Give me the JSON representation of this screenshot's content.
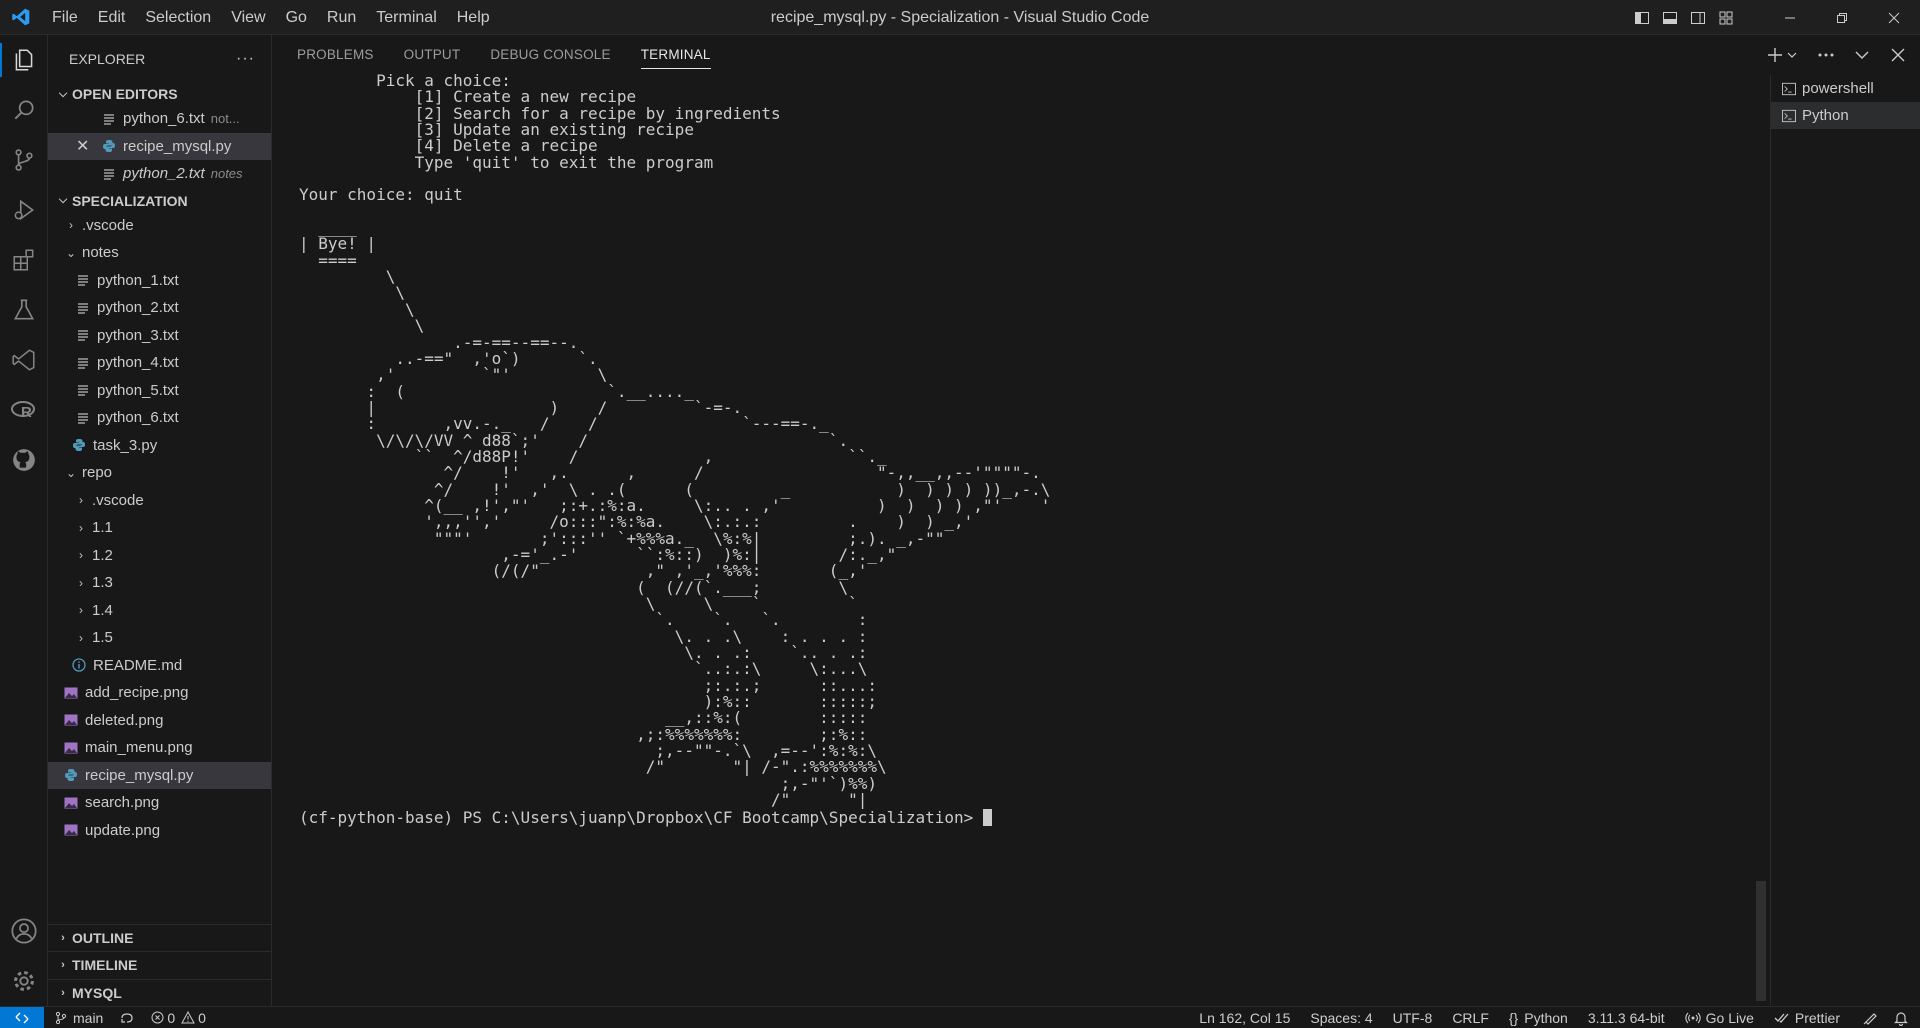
{
  "window": {
    "title": "recipe_mysql.py - Specialization - Visual Studio Code",
    "menu": [
      "File",
      "Edit",
      "Selection",
      "View",
      "Go",
      "Run",
      "Terminal",
      "Help"
    ],
    "accent": "#0078d4"
  },
  "activity_bar": {
    "top": [
      "files-icon",
      "search-icon",
      "source-control-icon",
      "run-debug-icon",
      "extensions-icon",
      "testing-icon",
      "visual-studio-icon",
      "r-icon",
      "github-icon"
    ],
    "bottom": [
      "accounts-icon",
      "settings-gear-icon"
    ]
  },
  "sidebar": {
    "title": "EXPLORER",
    "more": "···",
    "open_editors": {
      "label": "OPEN EDITORS",
      "items": [
        {
          "name": "python_6.txt",
          "desc": "not..."
        },
        {
          "name": "recipe_mysql.py",
          "close": "✕"
        },
        {
          "name": "python_2.txt",
          "desc": "notes"
        }
      ]
    },
    "workspace": {
      "label": "SPECIALIZATION",
      "items": [
        {
          "name": ".vscode"
        },
        {
          "name": "notes"
        },
        {
          "name": "python_1.txt"
        },
        {
          "name": "python_2.txt"
        },
        {
          "name": "python_3.txt"
        },
        {
          "name": "python_4.txt"
        },
        {
          "name": "python_5.txt"
        },
        {
          "name": "python_6.txt"
        },
        {
          "name": "task_3.py"
        },
        {
          "name": "repo"
        },
        {
          "name": ".vscode"
        },
        {
          "name": "1.1"
        },
        {
          "name": "1.2"
        },
        {
          "name": "1.3"
        },
        {
          "name": "1.4"
        },
        {
          "name": "1.5"
        },
        {
          "name": "README.md"
        },
        {
          "name": "add_recipe.png"
        },
        {
          "name": "deleted.png"
        },
        {
          "name": "main_menu.png"
        },
        {
          "name": "recipe_mysql.py"
        },
        {
          "name": "search.png"
        },
        {
          "name": "update.png"
        }
      ]
    },
    "bottom_sections": [
      "OUTLINE",
      "TIMELINE",
      "MYSQL"
    ]
  },
  "panel": {
    "tabs": [
      "PROBLEMS",
      "OUTPUT",
      "DEBUG CONSOLE",
      "TERMINAL"
    ],
    "active_tab": "TERMINAL",
    "terminals": [
      "powershell",
      "Python"
    ],
    "active_terminal": "Python",
    "terminal_output": "        Pick a choice:\n            [1] Create a new recipe\n            [2] Search for a recipe by ingredients\n            [3] Update an existing recipe\n            [4] Delete a recipe\n            Type 'quit' to exit the program\n\nYour choice: quit\n\n  ____\n| Bye! |\n  ====\n         \\\n          \\\n           \\\n            \\\n                .-=-==--==--.\n          ..-==\"  ,'o`)      `.\n        ,'         `\"'         \\\n       :  (                     `.__...._\n       |                  )    /         `-=-.\n       :       ,vv.-._   /    /               `---==-._\n        \\/\\/\\/VV ^ d88`;'    /                         `.\n            ``  ^/d88P!'    /             ,              ``._\n               ^/    !'   ,.      ,      /                  \"-,,__,,--'\"\"\"\"-.\n              ^/    !'  ,'  \\ . .(      (         _           )  ) ) ) ))_,-.\\\n             ^(__ ,!',\"'   ;:+.:%:a.     \\:.. . ,'          )  )  ) ) ,\"'    '\n             ',,,'','     /o:::\":%:%a.    \\:.:.:         .    )  ) _,'\n              \"\"\"'       ;':::'' `+%%%a._  \\%:%|         ;.). _,-\"\"\n                     ,-='_.-'      ``:%::)  )%:|        /:._,\"\n                    (/(/\"           ,\" ,'_,'%%%:       (_,'\n                                   (  (//(`.___;        \\\n                                    \\     \\    `         `\n                                     `.    `.   `.        :\n                                       \\. . .\\    : . . . :\n                                        \\. . .:    `.. . .:\n                                         `..:.:\\     \\:...\\\n                                          ;:.:.;      ::...:\n                                          ):%::       :::::;\n                                      __,::%:(        :::::\n                                   ,;:%%%%%%%:        ;:%::\n                                     ;,--\"\"-.`\\  ,=--':%:%:\\\n                                    /\"       \"| /-\".:%%%%%%%\\\n                                                  ;,-\"'`)%%)\n                                                 /\"      \"|",
    "prompt": "(cf-python-base) PS C:\\Users\\juanp\\Dropbox\\CF Bootcamp\\Specialization> "
  },
  "status_bar": {
    "branch": "main",
    "errors": "0",
    "warnings": "0",
    "position": "Ln 162, Col 15",
    "spaces": "Spaces: 4",
    "encoding": "UTF-8",
    "eol": "CRLF",
    "language": "Python",
    "interpreter": "3.11.3 64-bit",
    "go_live": "Go Live",
    "prettier": "Prettier"
  }
}
